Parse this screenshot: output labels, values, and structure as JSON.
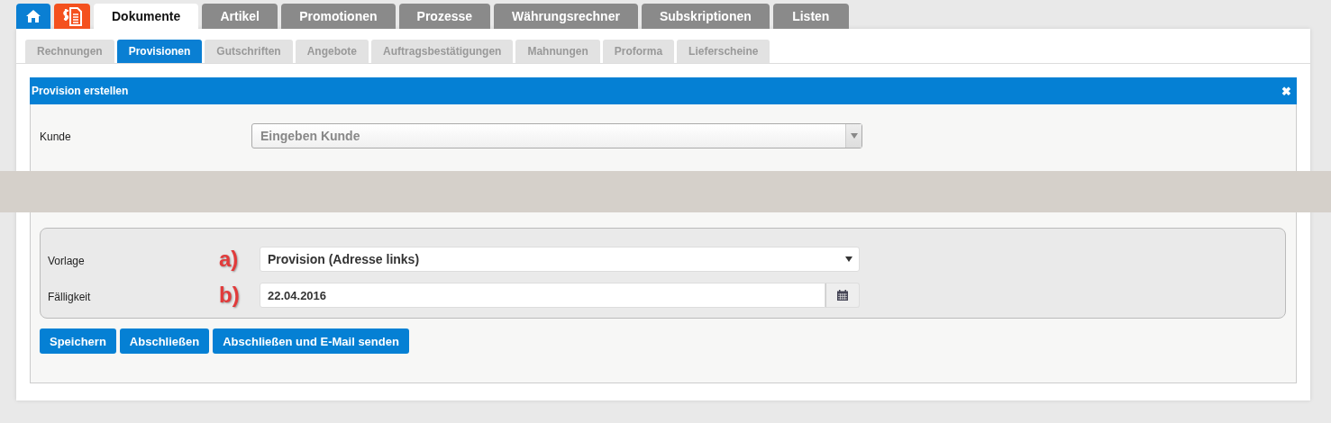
{
  "main_tabs": [
    {
      "kind": "home",
      "selected": false
    },
    {
      "kind": "invoice",
      "selected": false
    },
    {
      "kind": "text",
      "label": "Dokumente",
      "selected": true
    },
    {
      "kind": "text",
      "label": "Artikel",
      "selected": false
    },
    {
      "kind": "text",
      "label": "Promotionen",
      "selected": false
    },
    {
      "kind": "text",
      "label": "Prozesse",
      "selected": false
    },
    {
      "kind": "text",
      "label": "Währungsrechner",
      "selected": false
    },
    {
      "kind": "text",
      "label": "Subskriptionen",
      "selected": false
    },
    {
      "kind": "text",
      "label": "Listen",
      "selected": false
    }
  ],
  "sub_tabs": [
    {
      "label": "Rechnungen",
      "selected": false
    },
    {
      "label": "Provisionen",
      "selected": true
    },
    {
      "label": "Gutschriften",
      "selected": false
    },
    {
      "label": "Angebote",
      "selected": false
    },
    {
      "label": "Auftragsbestätigungen",
      "selected": false
    },
    {
      "label": "Mahnungen",
      "selected": false
    },
    {
      "label": "Proforma",
      "selected": false
    },
    {
      "label": "Lieferscheine",
      "selected": false
    }
  ],
  "panel": {
    "title": "Provision erstellen",
    "close": "✖",
    "customer": {
      "label": "Kunde",
      "placeholder": "Eingeben Kunde"
    },
    "template": {
      "label": "Vorlage",
      "marker": "a)",
      "value": "Provision (Adresse links)"
    },
    "due": {
      "label": "Fälligkeit",
      "marker": "b)",
      "value": "22.04.2016"
    },
    "buttons": [
      "Speichern",
      "Abschließen",
      "Abschließen und E-Mail senden"
    ]
  }
}
